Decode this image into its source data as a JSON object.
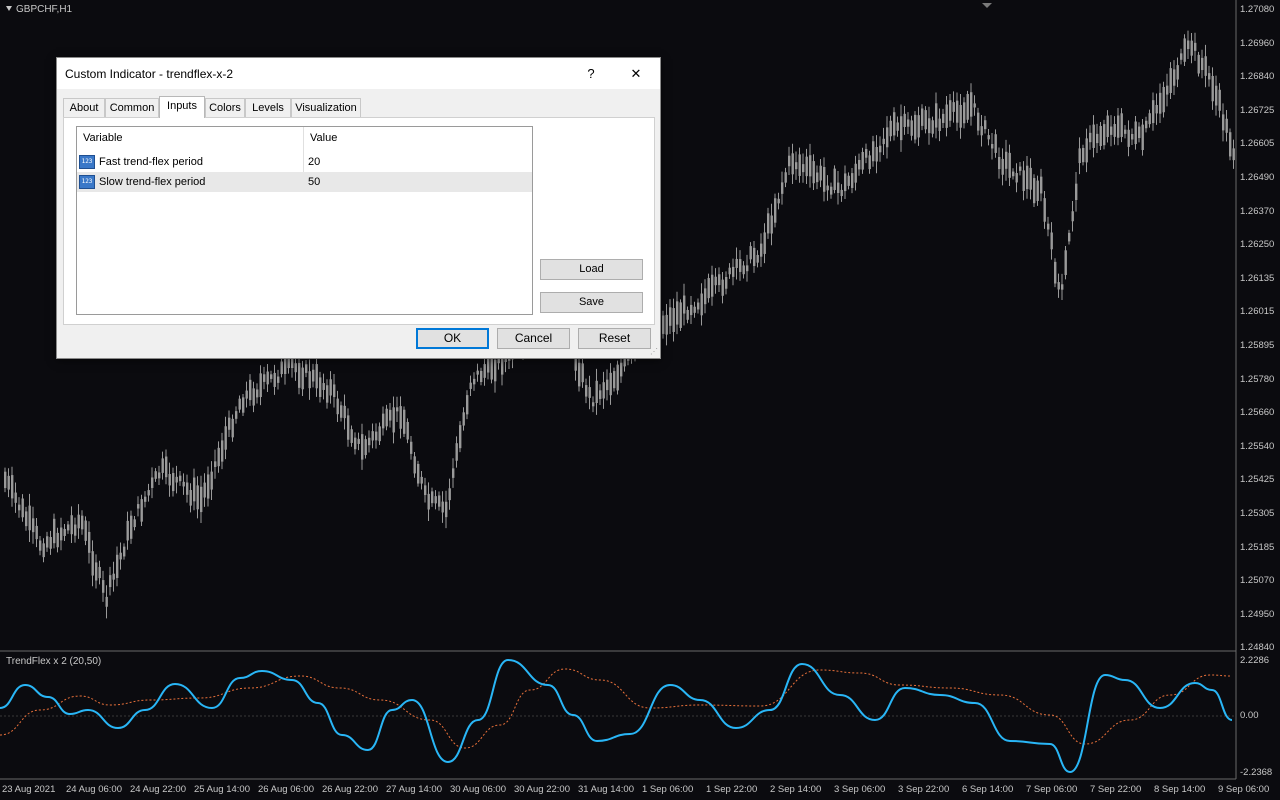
{
  "chart": {
    "symbol": "GBPCHF,H1",
    "indicator_label": "TrendFlex x 2 (20,50)",
    "price_ticks": [
      "1.27080",
      "1.26960",
      "1.26840",
      "1.26725",
      "1.26605",
      "1.26490",
      "1.26370",
      "1.26250",
      "1.26135",
      "1.26015",
      "1.25895",
      "1.25780",
      "1.25660",
      "1.25540",
      "1.25425",
      "1.25305",
      "1.25185",
      "1.25070",
      "1.24950",
      "1.24840"
    ],
    "indicator_ticks": [
      "2.2286",
      "0.00",
      "-2.2368"
    ],
    "time_ticks": [
      "23 Aug 2021",
      "24 Aug 06:00",
      "24 Aug 22:00",
      "25 Aug 14:00",
      "26 Aug 06:00",
      "26 Aug 22:00",
      "27 Aug 14:00",
      "30 Aug 06:00",
      "30 Aug 22:00",
      "31 Aug 14:00",
      "1 Sep 06:00",
      "1 Sep 22:00",
      "2 Sep 14:00",
      "3 Sep 06:00",
      "3 Sep 22:00",
      "6 Sep 14:00",
      "7 Sep 06:00",
      "7 Sep 22:00",
      "8 Sep 14:00",
      "9 Sep 06:00"
    ],
    "colors": {
      "background": "#0b0b0f",
      "candles": "#9a9a9a",
      "fast_line": "#29b6f6",
      "slow_line": "#e8703a"
    }
  },
  "dialog": {
    "title": "Custom Indicator - trendflex-x-2",
    "help_label": "?",
    "close_label": "✕",
    "tabs": [
      "About",
      "Common",
      "Inputs",
      "Colors",
      "Levels",
      "Visualization"
    ],
    "active_tab": "Inputs",
    "columns": {
      "variable": "Variable",
      "value": "Value"
    },
    "rows": [
      {
        "icon": "123",
        "variable": "Fast trend-flex period",
        "value": "20"
      },
      {
        "icon": "123",
        "variable": "Slow trend-flex period",
        "value": "50"
      }
    ],
    "load_label": "Load",
    "save_label": "Save",
    "ok_label": "OK",
    "cancel_label": "Cancel",
    "reset_label": "Reset"
  }
}
